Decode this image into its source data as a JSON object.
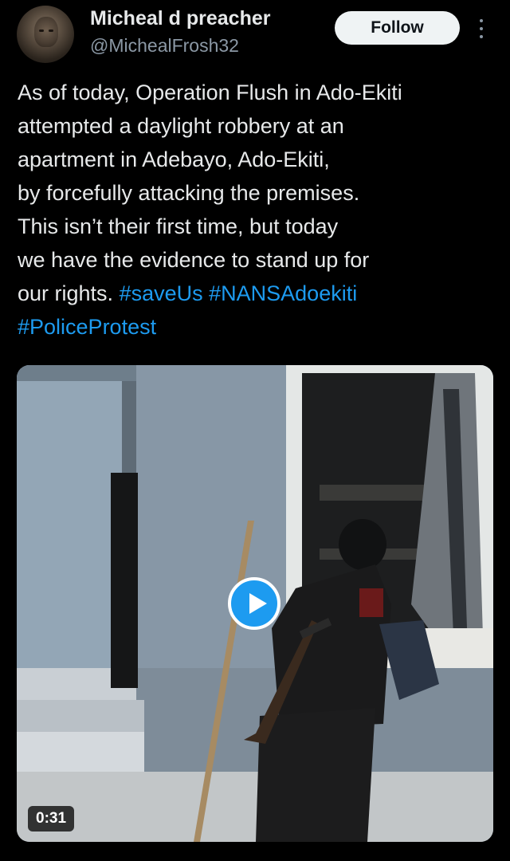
{
  "author": {
    "display_name": "Micheal d preacher",
    "handle": "@MichealFrosh32",
    "avatar_icon": "profile-photo"
  },
  "actions": {
    "follow_label": "Follow",
    "more_icon": "more-vertical-icon"
  },
  "tweet": {
    "lines": [
      "As of today, Operation Flush in Ado-Ekiti",
      "attempted a daylight robbery at an",
      "apartment in Adebayo, Ado-Ekiti,",
      "by forcefully attacking the premises.",
      "This isn’t their first time, but today",
      "we have the evidence to stand up for"
    ],
    "last_line_text": "our rights. ",
    "hashtags": [
      "#saveUs",
      "#NANSAdoekiti",
      "#PoliceProtest"
    ]
  },
  "media": {
    "type": "video",
    "duration": "0:31",
    "play_icon": "play-icon"
  },
  "colors": {
    "background": "#000000",
    "text": "#e7e9ea",
    "secondary_text": "#8b98a5",
    "link": "#1d9bf0",
    "follow_button_bg": "#eff3f4"
  }
}
